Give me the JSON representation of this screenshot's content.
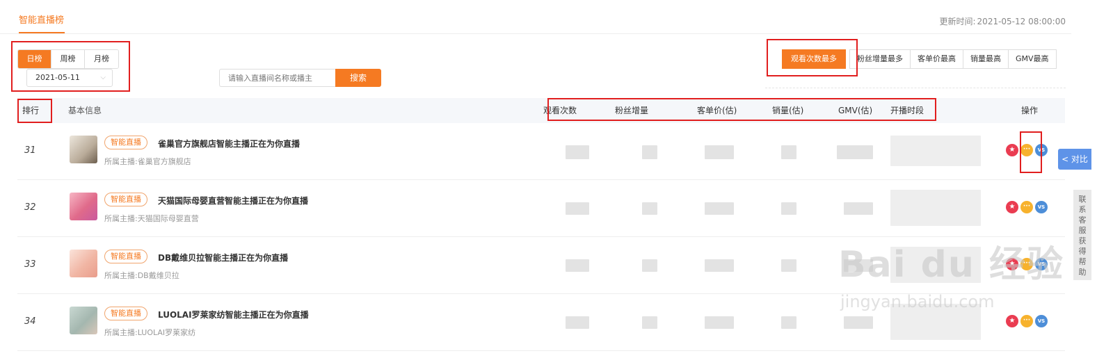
{
  "header": {
    "tab": "智能直播榜",
    "update_label": "更新时间:",
    "update_time": "2021-05-12 08:00:00"
  },
  "period": {
    "tabs": [
      "日榜",
      "周榜",
      "月榜"
    ],
    "active": 0,
    "date": "2021-05-11"
  },
  "search": {
    "placeholder": "请输入直播间名称或播主",
    "button": "搜索"
  },
  "sort": {
    "buttons": [
      "观看次数最多",
      "粉丝增量最多",
      "客单价最高",
      "销量最高",
      "GMV最高"
    ],
    "active": 0
  },
  "table": {
    "columns": [
      "排行",
      "基本信息",
      "观看次数",
      "粉丝增量",
      "客单价(估)",
      "销量(估)",
      "GMV(估)",
      "开播时段",
      "操作"
    ],
    "rows": [
      {
        "rank": "31",
        "tag": "智能直播",
        "name": "雀巢官方旗舰店智能主播正在为你直播",
        "anchor": "所属主播:雀巢官方旗舰店",
        "thumb_color": "#cfc8bd"
      },
      {
        "rank": "32",
        "tag": "智能直播",
        "name": "天猫国际母婴直营智能主播正在为你直播",
        "anchor": "所属主播:天猫国际母婴直营",
        "thumb_color": "#ef8fa4"
      },
      {
        "rank": "33",
        "tag": "智能直播",
        "name": "DB戴维贝拉智能主播正在为你直播",
        "anchor": "所属主播:DB戴维贝拉",
        "thumb_color": "#f3c6b8"
      },
      {
        "rank": "34",
        "tag": "智能直播",
        "name": "LUOLAI罗莱家纺智能主播正在为你直播",
        "anchor": "所属主播:LUOLAI罗莱家纺",
        "thumb_color": "#a9bfb5"
      }
    ],
    "ops": {
      "star": "★",
      "more": "···",
      "vs": "VS"
    }
  },
  "side": {
    "compare": "< 对比",
    "service": "联系客服获得帮助"
  },
  "watermark": {
    "main": "Bai du 经验",
    "sub": "jingyan.baidu.com"
  },
  "colors": {
    "accent": "#f57a22",
    "highlight": "#e11e1e",
    "compare": "#5e93e8"
  }
}
